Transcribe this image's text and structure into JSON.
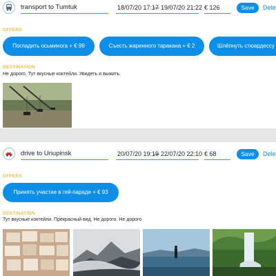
{
  "events": [
    {
      "type_icon": "bus-icon",
      "destination": "transport to Tumtuk",
      "date_start": "18/07/20 17:17",
      "date_separator": "—",
      "date_end": "19/07/20 21:22",
      "price": "€ 126",
      "save_label": "Save",
      "delete_label": "Delete",
      "offers_title": "OFFERS",
      "offers": [
        {
          "label": "Погладить осьминога + €  99"
        },
        {
          "label": "Съесть жаренного таракана + €  2"
        },
        {
          "label": "Шлёпнуть стюардессу"
        }
      ],
      "destination_title": "DESTINATION",
      "description": "Не дорого. Тут вкусные коктейли. Увидеть и выжить"
    },
    {
      "type_icon": "car-icon",
      "destination": "drive to Uriupinsk",
      "date_start": "20/07/20 19:19",
      "date_separator": "—",
      "date_end": "22/07/20 22:10",
      "price": "€ 68",
      "save_label": "Save",
      "delete_label": "Delete",
      "offers_title": "OFFERS",
      "offers": [
        {
          "label": "Принять участие в гей-параде + €  93"
        }
      ],
      "destination_title": "DESTINATION",
      "description": "Тут вкусные коктейли. Прекрасный вид. Не дорого. Не дорого"
    }
  ],
  "colors": {
    "accent": "#0d8fe8",
    "section_title": "#f6b93b",
    "separator": "#e7e7e7"
  }
}
